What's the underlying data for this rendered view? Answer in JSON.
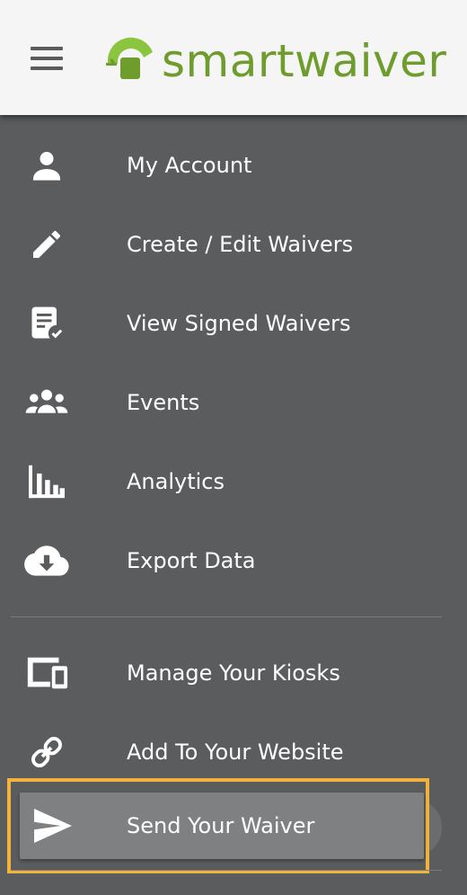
{
  "header": {
    "logo_text": "smartwaiver",
    "brand_color": "#6e9c2d"
  },
  "menu": {
    "items": [
      {
        "label": "My Account",
        "icon": "person-icon"
      },
      {
        "label": "Create / Edit Waivers",
        "icon": "pencil-icon"
      },
      {
        "label": "View Signed Waivers",
        "icon": "signed-document-icon"
      },
      {
        "label": "Events",
        "icon": "group-icon"
      },
      {
        "label": "Analytics",
        "icon": "bar-chart-icon"
      },
      {
        "label": "Export Data",
        "icon": "cloud-download-icon"
      }
    ],
    "secondary_items": [
      {
        "label": "Manage Your Kiosks",
        "icon": "devices-icon"
      },
      {
        "label": "Add To Your Website",
        "icon": "link-icon"
      },
      {
        "label": "Send Your Waiver",
        "icon": "send-icon",
        "selected": true
      }
    ],
    "highlight_color": "#f3b23b"
  }
}
